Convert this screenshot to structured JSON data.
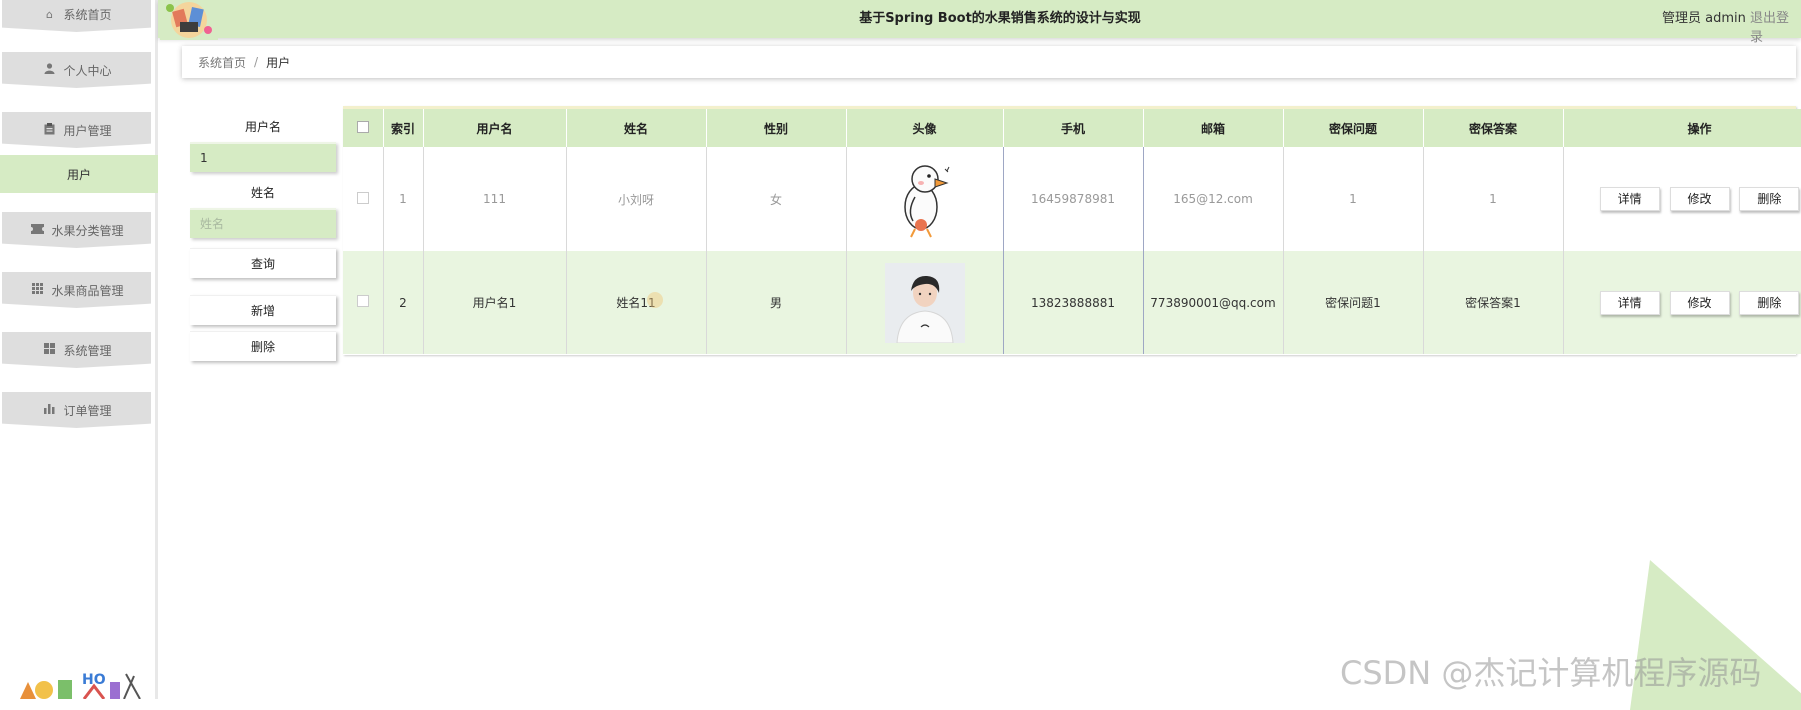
{
  "app": {
    "title": "基于Spring Boot的水果销售系统的设计与实现",
    "user_label": "管理员 admin",
    "logout_label": "退出登录"
  },
  "sidebar": {
    "items": [
      {
        "label": "系统首页",
        "icon": "home-icon",
        "glyph": "⌂"
      },
      {
        "label": "个人中心",
        "icon": "person-icon",
        "glyph": "👤"
      },
      {
        "label": "用户管理",
        "icon": "clipboard-icon",
        "glyph": "▤"
      },
      {
        "label": "用户",
        "icon": "",
        "glyph": ""
      },
      {
        "label": "水果分类管理",
        "icon": "ticket-icon",
        "glyph": "▰"
      },
      {
        "label": "水果商品管理",
        "icon": "grid-icon",
        "glyph": "▦"
      },
      {
        "label": "系统管理",
        "icon": "tiles-icon",
        "glyph": "▪"
      },
      {
        "label": "订单管理",
        "icon": "bar-chart-icon",
        "glyph": "▮"
      }
    ]
  },
  "breadcrumb": {
    "home": "系统首页",
    "separator": "/",
    "current": "用户"
  },
  "search": {
    "username_label": "用户名",
    "username_value": "1",
    "name_label": "姓名",
    "name_placeholder": "姓名",
    "query_button": "查询",
    "add_button": "新增",
    "delete_button": "删除"
  },
  "table": {
    "headers": [
      "索引",
      "用户名",
      "姓名",
      "性别",
      "头像",
      "手机",
      "邮箱",
      "密保问题",
      "密保答案",
      "操作"
    ],
    "rows": [
      {
        "index": "1",
        "username": "111",
        "name": "小刘呀",
        "gender": "女",
        "avatar": "duck-cartoon-avatar",
        "phone": "16459878981",
        "email": "165@12.com",
        "question": "1",
        "answer": "1"
      },
      {
        "index": "2",
        "username": "用户名1",
        "name": "姓名11",
        "gender": "男",
        "avatar": "person-photo-avatar",
        "phone": "13823888881",
        "email": "773890001@qq.com",
        "question": "密保问题1",
        "answer": "密保答案1"
      }
    ],
    "actions": {
      "detail": "详情",
      "edit": "修改",
      "delete": "删除"
    }
  },
  "watermark": "CSDN @杰记计算机程序源码",
  "colors": {
    "accent": "#d6ebc4",
    "row_alt": "#e9f5e0",
    "menu_bg": "#dedede"
  }
}
